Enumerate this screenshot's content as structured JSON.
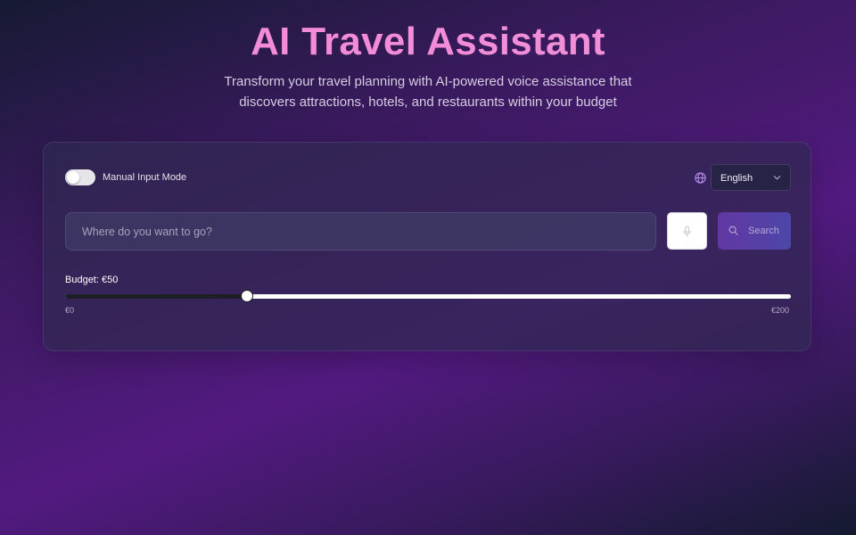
{
  "hero": {
    "title": "AI Travel Assistant",
    "subtitle": "Transform your travel planning with AI-powered voice assistance that discovers attractions, hotels, and restaurants within your budget"
  },
  "controls": {
    "manual_mode_label": "Manual Input Mode",
    "manual_mode_on": false,
    "language_icon": "globe-icon",
    "language_selected": "English"
  },
  "search": {
    "placeholder": "Where do you want to go?",
    "value": "",
    "mic_icon": "mic-icon",
    "button_icon": "search-icon",
    "button_label": "Search"
  },
  "budget": {
    "label": "Budget: €50",
    "value": 50,
    "min": 0,
    "max": 200,
    "min_label": "€0",
    "max_label": "€200"
  },
  "colors": {
    "title_gradient_start": "#f08ad2",
    "title_gradient_end": "#c79ae8",
    "search_button_start": "#6a3cb0",
    "search_button_end": "#4f4db5",
    "globe_icon": "#b98cf0"
  }
}
